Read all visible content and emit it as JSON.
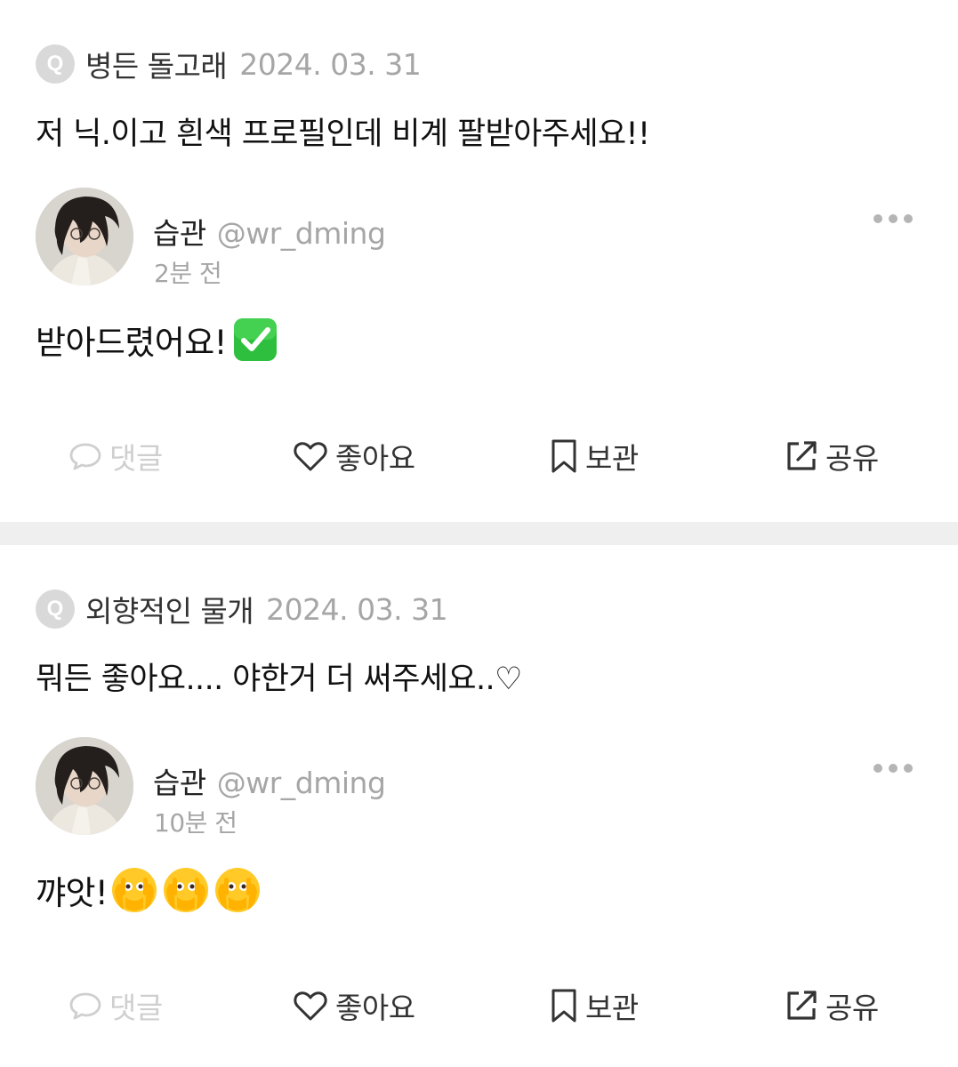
{
  "posts": [
    {
      "asker": "병든 돌고래",
      "date": "2024. 03. 31",
      "question": "저 닉.이고 흰색 프로필인데 비계 팔받아주세요!!",
      "author": {
        "name": "습관",
        "handle": "@wr_dming",
        "time": "2분 전"
      },
      "answer": "받아드렸어요!",
      "answer_emoji": "white-check-mark"
    },
    {
      "asker": "외향적인 물개",
      "date": "2024. 03. 31",
      "question": "뭐든 좋아요.... 야한거 더 써주세요..♡",
      "author": {
        "name": "습관",
        "handle": "@wr_dming",
        "time": "10분 전"
      },
      "answer": "꺄앗!",
      "answer_emoji": "face-with-open-eyes-and-hand-over-mouth x3"
    }
  ],
  "q_badge": "Q",
  "actions": {
    "comment": "댓글",
    "like": "좋아요",
    "save": "보관",
    "share": "공유"
  },
  "icons": [
    "q-badge-icon",
    "more-icon",
    "comment-icon",
    "heart-icon",
    "bookmark-icon",
    "share-icon"
  ],
  "colors": {
    "muted": "#a6a6a6",
    "disabled": "#cfcfcf",
    "text": "#111111",
    "divider": "#efefef",
    "badge": "#d9d9d9"
  }
}
